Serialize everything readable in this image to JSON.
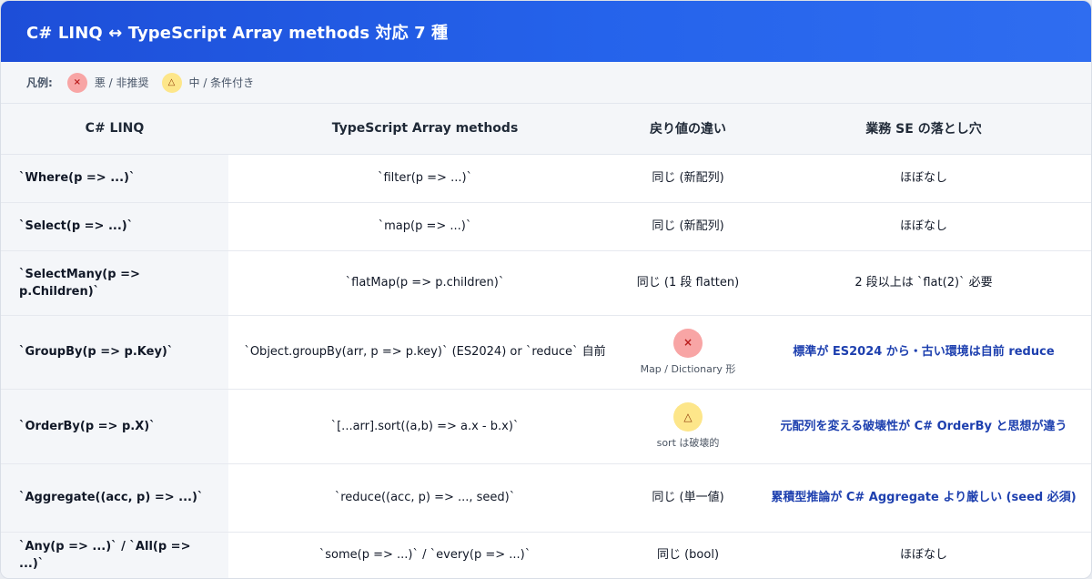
{
  "title": "C# LINQ ↔ TypeScript Array methods 対応 7 種",
  "legend": {
    "label": "凡例:",
    "items": [
      {
        "symbol": "×",
        "kind": "bad",
        "text": "悪 / 非推奨"
      },
      {
        "symbol": "△",
        "kind": "mid",
        "text": "中 / 条件付き"
      }
    ]
  },
  "columns": [
    "C# LINQ",
    "TypeScript Array methods",
    "戻り値の違い",
    "業務 SE の落とし穴"
  ],
  "rows": [
    {
      "linq": "`Where(p => ...)`",
      "ts": "`filter(p => ...)`",
      "ret": "同じ (新配列)",
      "ret_badge": "",
      "ret_note": "",
      "pitfall": "ほぼなし",
      "highlight": false
    },
    {
      "linq": "`Select(p => ...)`",
      "ts": "`map(p => ...)`",
      "ret": "同じ (新配列)",
      "ret_badge": "",
      "ret_note": "",
      "pitfall": "ほぼなし",
      "highlight": false
    },
    {
      "linq": "`SelectMany(p => p.Children)`",
      "ts": "`flatMap(p => p.children)`",
      "ret": "同じ (1 段 flatten)",
      "ret_badge": "",
      "ret_note": "",
      "pitfall": "2 段以上は `flat(2)` 必要",
      "highlight": false
    },
    {
      "linq": "`GroupBy(p => p.Key)`",
      "ts": "`Object.groupBy(arr, p => p.key)` (ES2024) or `reduce` 自前",
      "ret": "",
      "ret_badge": "×",
      "ret_badge_kind": "bad",
      "ret_note": "Map / Dictionary 形",
      "pitfall": "標準が ES2024 から・古い環境は自前 reduce",
      "highlight": true
    },
    {
      "linq": "`OrderBy(p => p.X)`",
      "ts": "`[...arr].sort((a,b) => a.x - b.x)`",
      "ret": "",
      "ret_badge": "△",
      "ret_badge_kind": "mid",
      "ret_note": "sort は破壊的",
      "pitfall": "元配列を変える破壊性が C# OrderBy と思想が違う",
      "highlight": true
    },
    {
      "linq": "`Aggregate((acc, p) => ...)`",
      "ts": "`reduce((acc, p) => ..., seed)`",
      "ret": "同じ (単一値)",
      "ret_badge": "",
      "ret_note": "",
      "pitfall": "累積型推論が C# Aggregate より厳しい (seed 必須)",
      "highlight": true
    },
    {
      "linq": "`Any(p => ...)` / `All(p => ...)`",
      "ts": "`some(p => ...)` / `every(p => ...)`",
      "ret": "同じ (bool)",
      "ret_badge": "",
      "ret_note": "",
      "pitfall": "ほぼなし",
      "highlight": false
    }
  ]
}
